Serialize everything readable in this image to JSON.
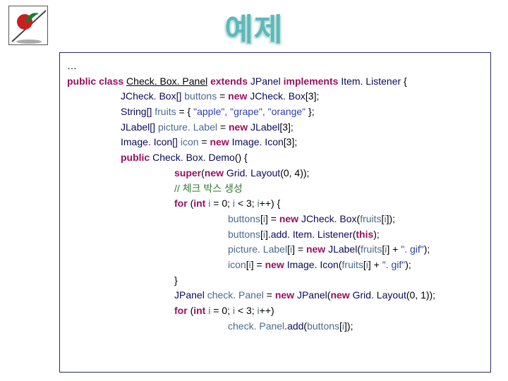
{
  "header": {
    "title": "예제"
  },
  "code": {
    "lines": [
      {
        "indent": "pad0",
        "segments": [
          {
            "cls": "c-plain",
            "t": "…"
          }
        ]
      },
      {
        "indent": "pad0",
        "segments": [
          {
            "cls": "c-keyword",
            "t": "public class "
          },
          {
            "cls": "c-class",
            "t": "Check. Box. Panel"
          },
          {
            "cls": "c-keyword",
            "t": " extends "
          },
          {
            "cls": "c-fn",
            "t": "JPanel"
          },
          {
            "cls": "c-keyword",
            "t": " implements "
          },
          {
            "cls": "c-fn",
            "t": "Item. Listener"
          },
          {
            "cls": "c-plain",
            "t": " {"
          }
        ]
      },
      {
        "indent": "pad1",
        "segments": [
          {
            "cls": "c-fn",
            "t": "JCheck. Box[] "
          },
          {
            "cls": "c-var",
            "t": "buttons"
          },
          {
            "cls": "c-plain",
            "t": " = "
          },
          {
            "cls": "c-keyword",
            "t": "new "
          },
          {
            "cls": "c-fn",
            "t": "JCheck. Box"
          },
          {
            "cls": "c-plain",
            "t": "[3];"
          }
        ]
      },
      {
        "indent": "pad1",
        "segments": [
          {
            "cls": "c-fn",
            "t": "String[] "
          },
          {
            "cls": "c-var",
            "t": "fruits"
          },
          {
            "cls": "c-plain",
            "t": " = { "
          },
          {
            "cls": "c-str",
            "t": "\"apple\", \"grape\", \"orange\""
          },
          {
            "cls": "c-plain",
            "t": " };"
          }
        ]
      },
      {
        "indent": "pad1",
        "segments": [
          {
            "cls": "c-fn",
            "t": "JLabel[] "
          },
          {
            "cls": "c-var",
            "t": "picture. Label"
          },
          {
            "cls": "c-plain",
            "t": " = "
          },
          {
            "cls": "c-keyword",
            "t": "new "
          },
          {
            "cls": "c-fn",
            "t": "JLabel"
          },
          {
            "cls": "c-plain",
            "t": "[3];"
          }
        ]
      },
      {
        "indent": "pad1",
        "segments": [
          {
            "cls": "c-fn",
            "t": "Image. Icon[] "
          },
          {
            "cls": "c-var",
            "t": "icon"
          },
          {
            "cls": "c-plain",
            "t": " = "
          },
          {
            "cls": "c-keyword",
            "t": "new "
          },
          {
            "cls": "c-fn",
            "t": "Image. Icon"
          },
          {
            "cls": "c-plain",
            "t": "[3];"
          }
        ]
      },
      {
        "indent": "pad1",
        "segments": [
          {
            "cls": "c-keyword",
            "t": "public "
          },
          {
            "cls": "c-fn",
            "t": "Check. Box. Demo"
          },
          {
            "cls": "c-plain",
            "t": "() {"
          }
        ]
      },
      {
        "indent": "pad2",
        "segments": [
          {
            "cls": "c-keyword",
            "t": "super"
          },
          {
            "cls": "c-plain",
            "t": "("
          },
          {
            "cls": "c-keyword",
            "t": "new "
          },
          {
            "cls": "c-fn",
            "t": "Grid. Layout"
          },
          {
            "cls": "c-plain",
            "t": "(0, 4));"
          }
        ]
      },
      {
        "indent": "pad2",
        "segments": [
          {
            "cls": "c-comment",
            "t": "// 체크 박스 생성"
          }
        ]
      },
      {
        "indent": "pad2",
        "segments": [
          {
            "cls": "c-keyword",
            "t": "for "
          },
          {
            "cls": "c-plain",
            "t": "("
          },
          {
            "cls": "c-keyword",
            "t": "int "
          },
          {
            "cls": "c-var",
            "t": "i"
          },
          {
            "cls": "c-plain",
            "t": " = 0; "
          },
          {
            "cls": "c-var",
            "t": "i"
          },
          {
            "cls": "c-plain",
            "t": " < 3; "
          },
          {
            "cls": "c-var",
            "t": "i"
          },
          {
            "cls": "c-plain",
            "t": "++) {"
          }
        ]
      },
      {
        "indent": "pad3",
        "segments": [
          {
            "cls": "c-var",
            "t": "buttons"
          },
          {
            "cls": "c-plain",
            "t": "["
          },
          {
            "cls": "c-var",
            "t": "i"
          },
          {
            "cls": "c-plain",
            "t": "] = "
          },
          {
            "cls": "c-keyword",
            "t": "new "
          },
          {
            "cls": "c-fn",
            "t": "JCheck. Box"
          },
          {
            "cls": "c-plain",
            "t": "("
          },
          {
            "cls": "c-var",
            "t": "fruits"
          },
          {
            "cls": "c-plain",
            "t": "["
          },
          {
            "cls": "c-var",
            "t": "i"
          },
          {
            "cls": "c-plain",
            "t": "]);"
          }
        ]
      },
      {
        "indent": "pad3",
        "segments": [
          {
            "cls": "c-var",
            "t": "buttons"
          },
          {
            "cls": "c-plain",
            "t": "["
          },
          {
            "cls": "c-var",
            "t": "i"
          },
          {
            "cls": "c-plain",
            "t": "]."
          },
          {
            "cls": "c-fn",
            "t": "add. Item. Listener"
          },
          {
            "cls": "c-plain",
            "t": "("
          },
          {
            "cls": "c-keyword",
            "t": "this"
          },
          {
            "cls": "c-plain",
            "t": ");"
          }
        ]
      },
      {
        "indent": "pad3",
        "segments": [
          {
            "cls": "c-var",
            "t": "picture. Label"
          },
          {
            "cls": "c-plain",
            "t": "["
          },
          {
            "cls": "c-var",
            "t": "i"
          },
          {
            "cls": "c-plain",
            "t": "] = "
          },
          {
            "cls": "c-keyword",
            "t": "new "
          },
          {
            "cls": "c-fn",
            "t": "JLabel"
          },
          {
            "cls": "c-plain",
            "t": "("
          },
          {
            "cls": "c-var",
            "t": "fruits"
          },
          {
            "cls": "c-plain",
            "t": "["
          },
          {
            "cls": "c-var",
            "t": "i"
          },
          {
            "cls": "c-plain",
            "t": "] + "
          },
          {
            "cls": "c-str",
            "t": "\". gif\""
          },
          {
            "cls": "c-plain",
            "t": ");"
          }
        ]
      },
      {
        "indent": "pad3",
        "segments": [
          {
            "cls": "c-var",
            "t": "icon"
          },
          {
            "cls": "c-plain",
            "t": "["
          },
          {
            "cls": "c-var",
            "t": "i"
          },
          {
            "cls": "c-plain",
            "t": "] = "
          },
          {
            "cls": "c-keyword",
            "t": "new "
          },
          {
            "cls": "c-fn",
            "t": "Image. Icon"
          },
          {
            "cls": "c-plain",
            "t": "("
          },
          {
            "cls": "c-var",
            "t": "fruits"
          },
          {
            "cls": "c-plain",
            "t": "["
          },
          {
            "cls": "c-var",
            "t": "i"
          },
          {
            "cls": "c-plain",
            "t": "] + "
          },
          {
            "cls": "c-str",
            "t": "\". gif\""
          },
          {
            "cls": "c-plain",
            "t": ");"
          }
        ]
      },
      {
        "indent": "pad2",
        "segments": [
          {
            "cls": "c-plain",
            "t": "}"
          }
        ]
      },
      {
        "indent": "pad2",
        "segments": [
          {
            "cls": "c-fn",
            "t": "JPanel "
          },
          {
            "cls": "c-var",
            "t": "check. Panel"
          },
          {
            "cls": "c-plain",
            "t": " = "
          },
          {
            "cls": "c-keyword",
            "t": "new "
          },
          {
            "cls": "c-fn",
            "t": "JPanel"
          },
          {
            "cls": "c-plain",
            "t": "("
          },
          {
            "cls": "c-keyword",
            "t": "new "
          },
          {
            "cls": "c-fn",
            "t": "Grid. Layout"
          },
          {
            "cls": "c-plain",
            "t": "(0, 1));"
          }
        ]
      },
      {
        "indent": "pad2",
        "segments": [
          {
            "cls": "c-keyword",
            "t": "for "
          },
          {
            "cls": "c-plain",
            "t": "("
          },
          {
            "cls": "c-keyword",
            "t": "int "
          },
          {
            "cls": "c-var",
            "t": "i"
          },
          {
            "cls": "c-plain",
            "t": " = 0; "
          },
          {
            "cls": "c-var",
            "t": "i"
          },
          {
            "cls": "c-plain",
            "t": " < 3; "
          },
          {
            "cls": "c-var",
            "t": "i"
          },
          {
            "cls": "c-plain",
            "t": "++)"
          }
        ]
      },
      {
        "indent": "pad3",
        "segments": [
          {
            "cls": "c-var",
            "t": "check. Panel"
          },
          {
            "cls": "c-plain",
            "t": "."
          },
          {
            "cls": "c-fn",
            "t": "add"
          },
          {
            "cls": "c-plain",
            "t": "("
          },
          {
            "cls": "c-var",
            "t": "buttons"
          },
          {
            "cls": "c-plain",
            "t": "["
          },
          {
            "cls": "c-var",
            "t": "i"
          },
          {
            "cls": "c-plain",
            "t": "]);"
          }
        ]
      }
    ]
  }
}
